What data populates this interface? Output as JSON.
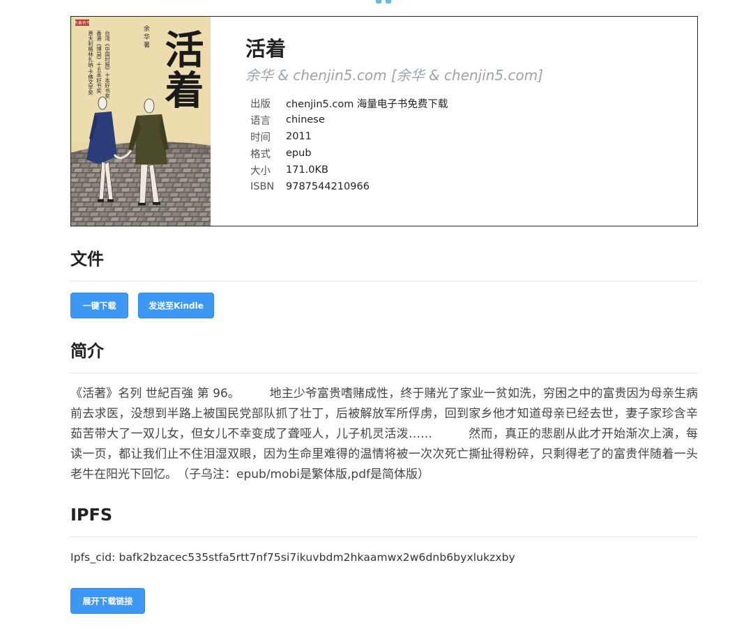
{
  "book": {
    "title": "活着",
    "author": "余华 & chenjin5.com [余华 & chenjin5.com]",
    "cover": {
      "title_text": "活着",
      "author_text": "余 华 著",
      "series_text": "名家名作",
      "blurb_lines": [
        "台湾《中国时报》十本好书奖",
        "香港《博益》十五本好书奖",
        "意大利格林扎纳·卡佛文学奖"
      ]
    },
    "meta": [
      {
        "key": "出版",
        "value": "chenjin5.com 海量电子书免费下载"
      },
      {
        "key": "语言",
        "value": "chinese"
      },
      {
        "key": "时间",
        "value": "2011"
      },
      {
        "key": "格式",
        "value": "epub"
      },
      {
        "key": "大小",
        "value": "171.0KB"
      },
      {
        "key": "ISBN",
        "value": "9787544210966"
      }
    ]
  },
  "files": {
    "heading": "文件",
    "download_label": "一键下载",
    "kindle_label": "发送至Kindle"
  },
  "intro": {
    "heading": "简介",
    "text": "《活著》名列 世紀百強 第 96。　　　地主少爷富贵嗜赌成性，终于赌光了家业一贫如洗，穷困之中的富贵因为母亲生病前去求医，没想到半路上被国民党部队抓了壮丁，后被解放军所俘虏，回到家乡他才知道母亲已经去世，妻子家珍含辛茹苦带大了一双儿女，但女儿不幸变成了聋哑人，儿子机灵活泼……　　　然而，真正的悲剧从此才开始渐次上演，每读一页，都让我们止不住泪湿双眼，因为生命里难得的温情将被一次次死亡撕扯得粉碎，只剩得老了的富贵伴随着一头老牛在阳光下回忆。　（子乌注：epub/mobi是繁体版,pdf是简体版）"
  },
  "ipfs": {
    "heading": "IPFS",
    "cid_line": "Ipfs_cid: bafk2bzacec535stfa5rtt7nf75si7ikuvbdm2hkaamwx2w6dnb6byxlukzxby",
    "expand_label": "展开下载链接"
  },
  "colors": {
    "button": "#3d97f5",
    "author": "#9aa3aa",
    "rule": "#e6e6e6"
  }
}
